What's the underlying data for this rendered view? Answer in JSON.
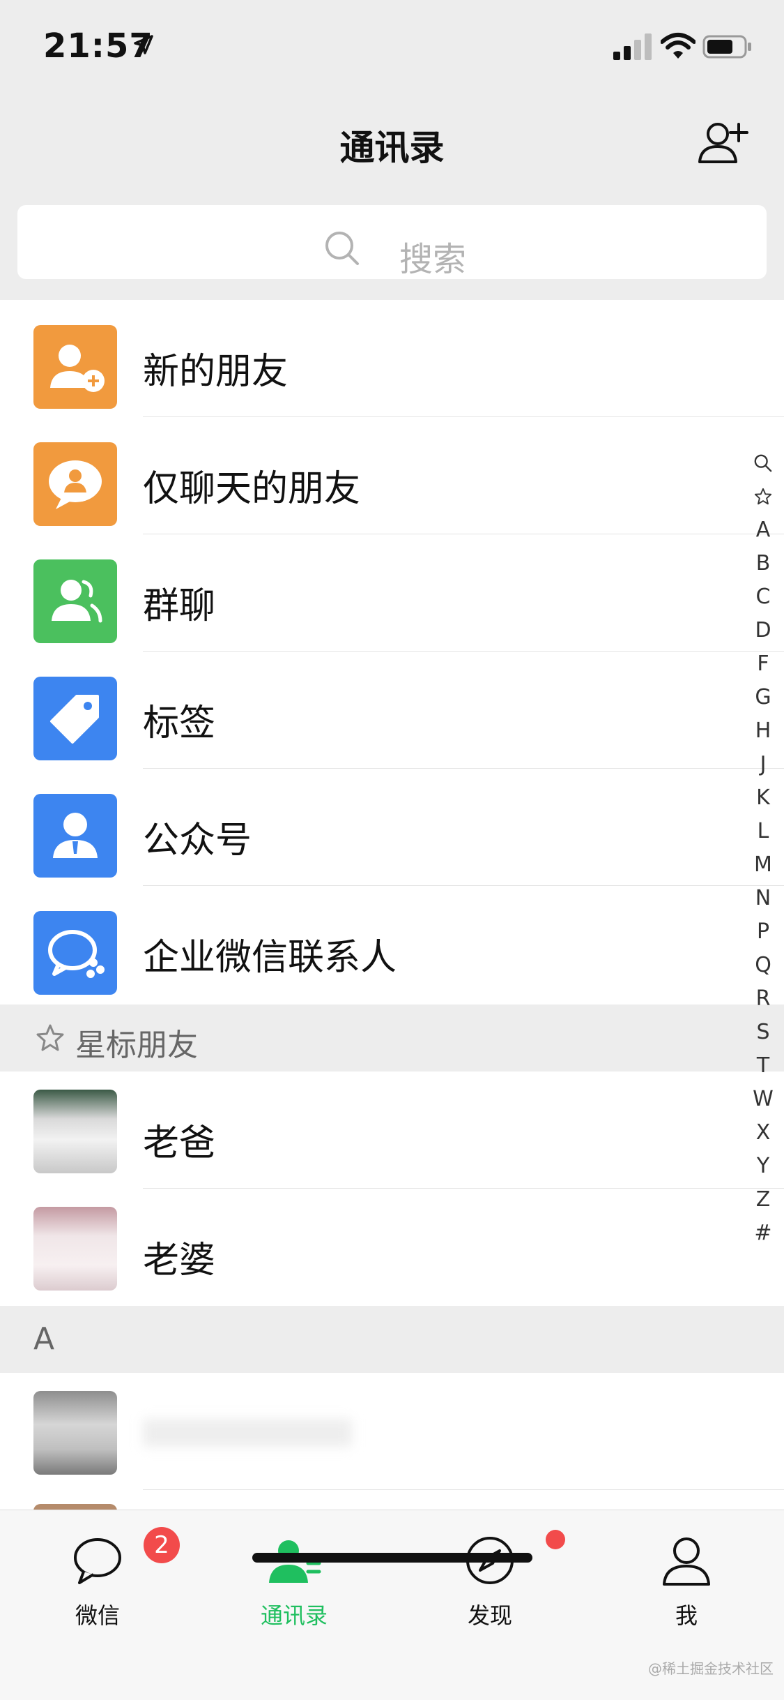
{
  "status": {
    "time": "21:57"
  },
  "header": {
    "title": "通讯录"
  },
  "search": {
    "placeholder": "搜索"
  },
  "functions": [
    {
      "label": "新的朋友",
      "icon": "new-friend-icon",
      "color": "#f19a3e"
    },
    {
      "label": "仅聊天的朋友",
      "icon": "chat-only-friend-icon",
      "color": "#f19a3e"
    },
    {
      "label": "群聊",
      "icon": "group-chat-icon",
      "color": "#4bc05e"
    },
    {
      "label": "标签",
      "icon": "tag-icon",
      "color": "#3d85f0"
    },
    {
      "label": "公众号",
      "icon": "official-account-icon",
      "color": "#3d85f0"
    },
    {
      "label": "企业微信联系人",
      "icon": "wecom-contact-icon",
      "color": "#3d85f0"
    }
  ],
  "starred": {
    "title": "星标朋友",
    "contacts": [
      {
        "name": "老爸"
      },
      {
        "name": "老婆"
      }
    ]
  },
  "section_a": {
    "title": "A"
  },
  "index": [
    "A",
    "B",
    "C",
    "D",
    "F",
    "G",
    "H",
    "J",
    "K",
    "L",
    "M",
    "N",
    "P",
    "Q",
    "R",
    "S",
    "T",
    "W",
    "X",
    "Y",
    "Z",
    "#"
  ],
  "tabs": [
    {
      "label": "微信",
      "badge": "2"
    },
    {
      "label": "通讯录"
    },
    {
      "label": "发现"
    },
    {
      "label": "我"
    }
  ],
  "watermark": "@稀土掘金技术社区",
  "colors": {
    "accent": "#1fbf5f",
    "badge": "#f24b4b"
  }
}
